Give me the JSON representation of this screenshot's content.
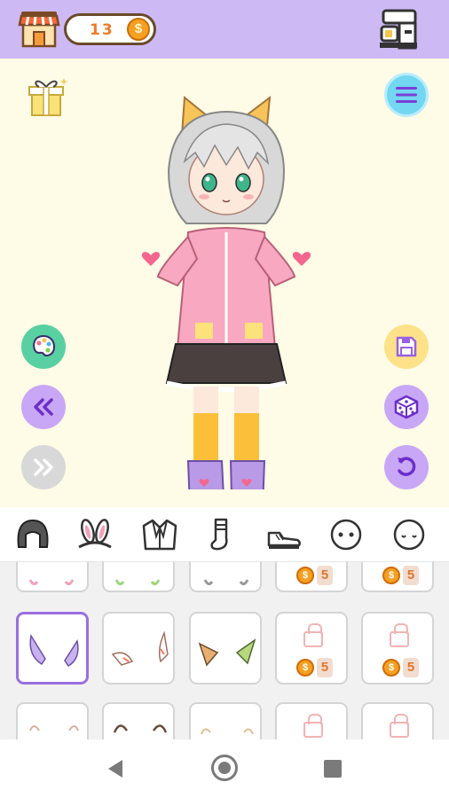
{
  "header": {
    "coins": "13",
    "coin_symbol": "$",
    "shop_icon": "shop-awning-icon",
    "cafe_icon": "coffee-machine-icon"
  },
  "stage": {
    "gift_icon": "gift-box-icon",
    "menu_icon": "hamburger-menu-icon",
    "left_buttons": [
      "palette-icon",
      "double-chevron-left-icon",
      "double-chevron-right-icon"
    ],
    "right_buttons": [
      "floppy-save-icon",
      "dice-icon",
      "undo-icon"
    ]
  },
  "categories": [
    {
      "icon": "hair-icon"
    },
    {
      "icon": "bunny-ears-icon"
    },
    {
      "icon": "jacket-icon"
    },
    {
      "icon": "sock-icon"
    },
    {
      "icon": "shoe-icon"
    },
    {
      "icon": "face-icon"
    },
    {
      "icon": "head-icon"
    }
  ],
  "items": {
    "row_top": [
      {
        "locked": false
      },
      {
        "locked": false
      },
      {
        "locked": false
      },
      {
        "locked": true,
        "price": "5"
      },
      {
        "locked": true,
        "price": "5"
      }
    ],
    "row_middle": [
      {
        "locked": false,
        "selected": true
      },
      {
        "locked": false
      },
      {
        "locked": false
      },
      {
        "locked": true,
        "price": "5"
      },
      {
        "locked": true,
        "price": "5"
      }
    ],
    "row_bottom": [
      {
        "locked": false
      },
      {
        "locked": false
      },
      {
        "locked": false
      },
      {
        "locked": true
      },
      {
        "locked": true
      }
    ]
  },
  "colors": {
    "header": "#cdb9f3",
    "stage": "#fefbe6",
    "accent": "#9a6fe0",
    "coin": "#f5a021"
  }
}
